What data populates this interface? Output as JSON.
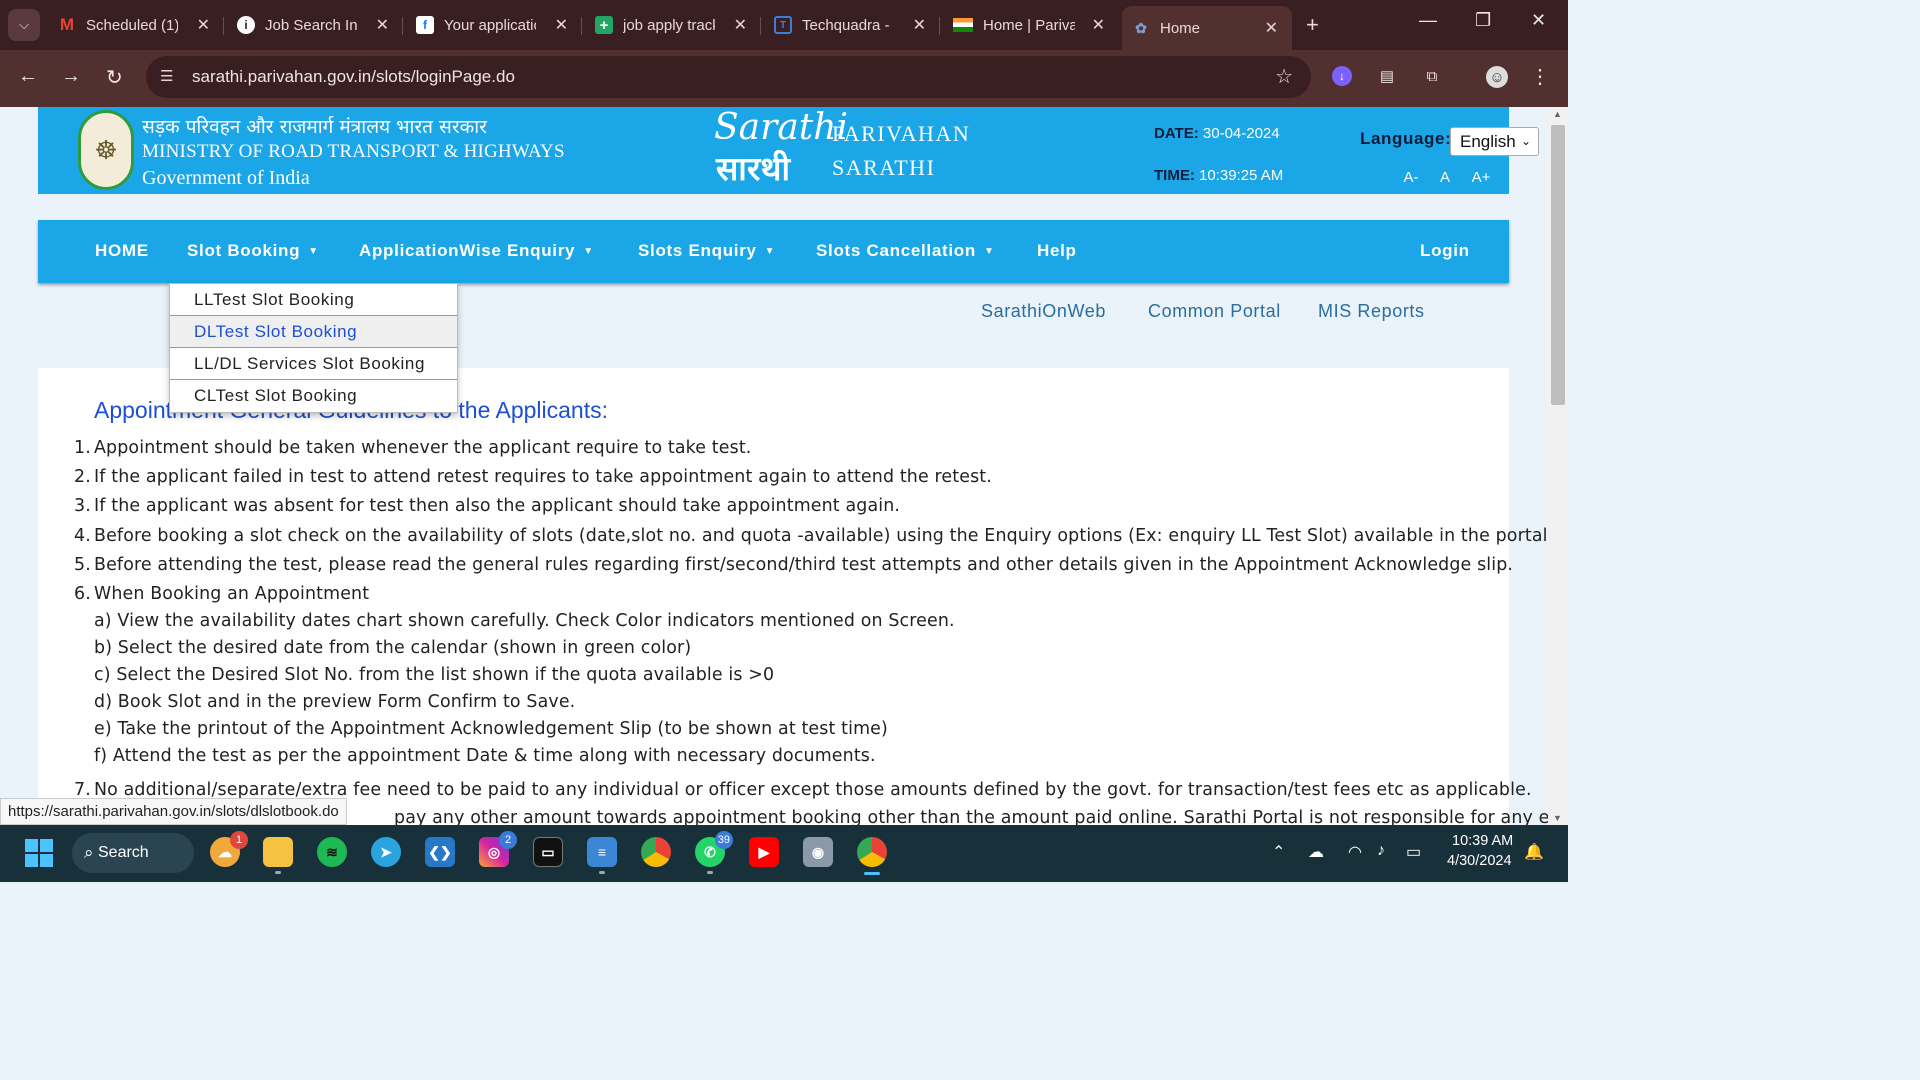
{
  "browser": {
    "tabs": [
      {
        "title": "Scheduled (1)",
        "icon": "gmail-icon",
        "color": "#ea4335"
      },
      {
        "title": "Job Search Inc",
        "icon": "info-icon",
        "color": "#ffffff"
      },
      {
        "title": "Your applicatio",
        "icon": "facebook-icon",
        "color": "#1877f2"
      },
      {
        "title": "job apply track",
        "icon": "sheets-plus-icon",
        "color": "#23a566"
      },
      {
        "title": "Techquadra - W",
        "icon": "techquadra-icon",
        "color": "#3d7dd8"
      },
      {
        "title": "Home | Parivah",
        "icon": "india-flag-icon",
        "color": "#ff9933"
      },
      {
        "title": "Home",
        "icon": "sarathi-tab-icon",
        "color": "#7d9ccf"
      }
    ],
    "address": "sarathi.parivahan.gov.in/slots/loginPage.do",
    "status_url": "https://sarathi.parivahan.gov.in/slots/dlslotbook.do"
  },
  "header": {
    "ministry_hindi": "सड़क परिवहन और राजमार्ग मंत्रालय भारत सरकार",
    "ministry_english": "MINISTRY OF ROAD TRANSPORT & HIGHWAYS",
    "government": "Government of India",
    "logo_english": "Sarathi",
    "logo_hindi": "सारथी",
    "brand_line1": "PARIVAHAN",
    "brand_line2": "SARATHI",
    "date_label": "DATE:",
    "date_value": "30-04-2024",
    "time_label": "TIME:",
    "time_value": "10:39:25 AM",
    "language_label": "Language:",
    "language_value": "English",
    "font_small": "A-",
    "font_normal": "A",
    "font_large": "A+",
    "accent": "#1aa6e7"
  },
  "menu": {
    "home": "HOME",
    "slot_booking": "Slot Booking",
    "application_enquiry": "ApplicationWise Enquiry",
    "slots_enquiry": "Slots Enquiry",
    "slots_cancellation": "Slots Cancellation",
    "help": "Help",
    "login": "Login"
  },
  "dropdown": [
    "LLTest Slot Booking",
    "DLTest Slot Booking",
    "LL/DL Services Slot Booking",
    "CLTest Slot Booking"
  ],
  "sublinks": {
    "sarathi_on_web": "SarathiOnWeb",
    "common_portal": "Common Portal",
    "mis_reports": "MIS Reports"
  },
  "guidelines": {
    "title": "Appointment General Guidelines to the Applicants:",
    "items": [
      {
        "num": "1.",
        "text": "Appointment should be taken whenever the applicant require to take test."
      },
      {
        "num": "2.",
        "text": "If the applicant failed in test to attend retest requires to take appointment again to attend the retest."
      },
      {
        "num": "3.",
        "text": "If the applicant was absent for test then also the applicant should take appointment again."
      },
      {
        "num": "4.",
        "text": "Before booking a slot check on the availability of slots (date,slot no. and quota -available) using the Enquiry options (Ex: enquiry LL Test Slot) available in the portal."
      },
      {
        "num": "5.",
        "text": "Before attending the test, please read the general rules regarding first/second/third test attempts and other details given in the Appointment Acknowledge slip."
      },
      {
        "num": "6.",
        "text": "When Booking an Appointment"
      }
    ],
    "subitems": [
      "a) View the availability dates chart shown carefully. Check Color indicators mentioned on Screen.",
      "b) Select the desired date from the calendar (shown in green color)",
      "c) Select the Desired Slot No. from the list shown if the quota available is >0",
      "d) Book Slot and in the preview Form Confirm to Save.",
      "e) Take the printout of the Appointment Acknowledgement Slip (to be shown at test time)",
      "f) Attend the test as per the appointment Date & time along with necessary documents."
    ],
    "item7": {
      "num": "7.",
      "text": "No additional/separate/extra fee need to be paid to any individual or officer except those amounts defined by the govt. for transaction/test fees etc as applicable."
    },
    "item8_partial": "pay any other amount towards appointment booking other than the amount paid online. Sarathi Portal is not responsible for any extra"
  },
  "taskbar": {
    "search_label": "Search",
    "weather_badge": "1",
    "instagram_badge": "2",
    "whatsapp_badge": "39",
    "clock_time": "10:39 AM",
    "clock_date": "4/30/2024"
  }
}
